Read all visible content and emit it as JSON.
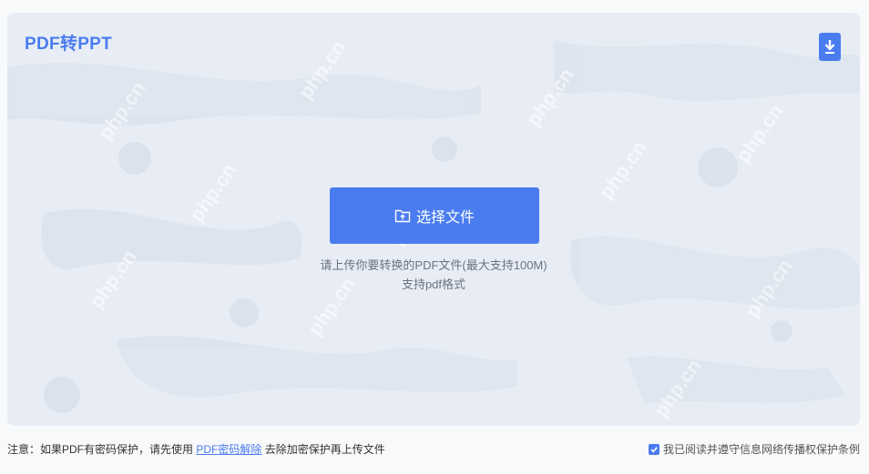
{
  "header": {
    "title": "PDF转PPT",
    "download_icon": "download-icon"
  },
  "upload": {
    "button_label": "选择文件",
    "button_icon": "folder-upload-icon",
    "hint_line1": "请上传你要转换的PDF文件(最大支持100M)",
    "hint_line2": "支持pdf格式"
  },
  "watermark": {
    "text": "php.cn"
  },
  "footer": {
    "notice_prefix": "注意：如果PDF有密码保护，请先使用",
    "notice_link": "PDF密码解除",
    "notice_suffix": "去除加密保护再上传文件",
    "agree_label": "我已阅读并遵守信息网络传播权保护条例",
    "agree_checked": true
  },
  "colors": {
    "accent": "#4a7cf0",
    "panel_bg": "#e8edf5",
    "page_bg": "#f8f9fb"
  }
}
